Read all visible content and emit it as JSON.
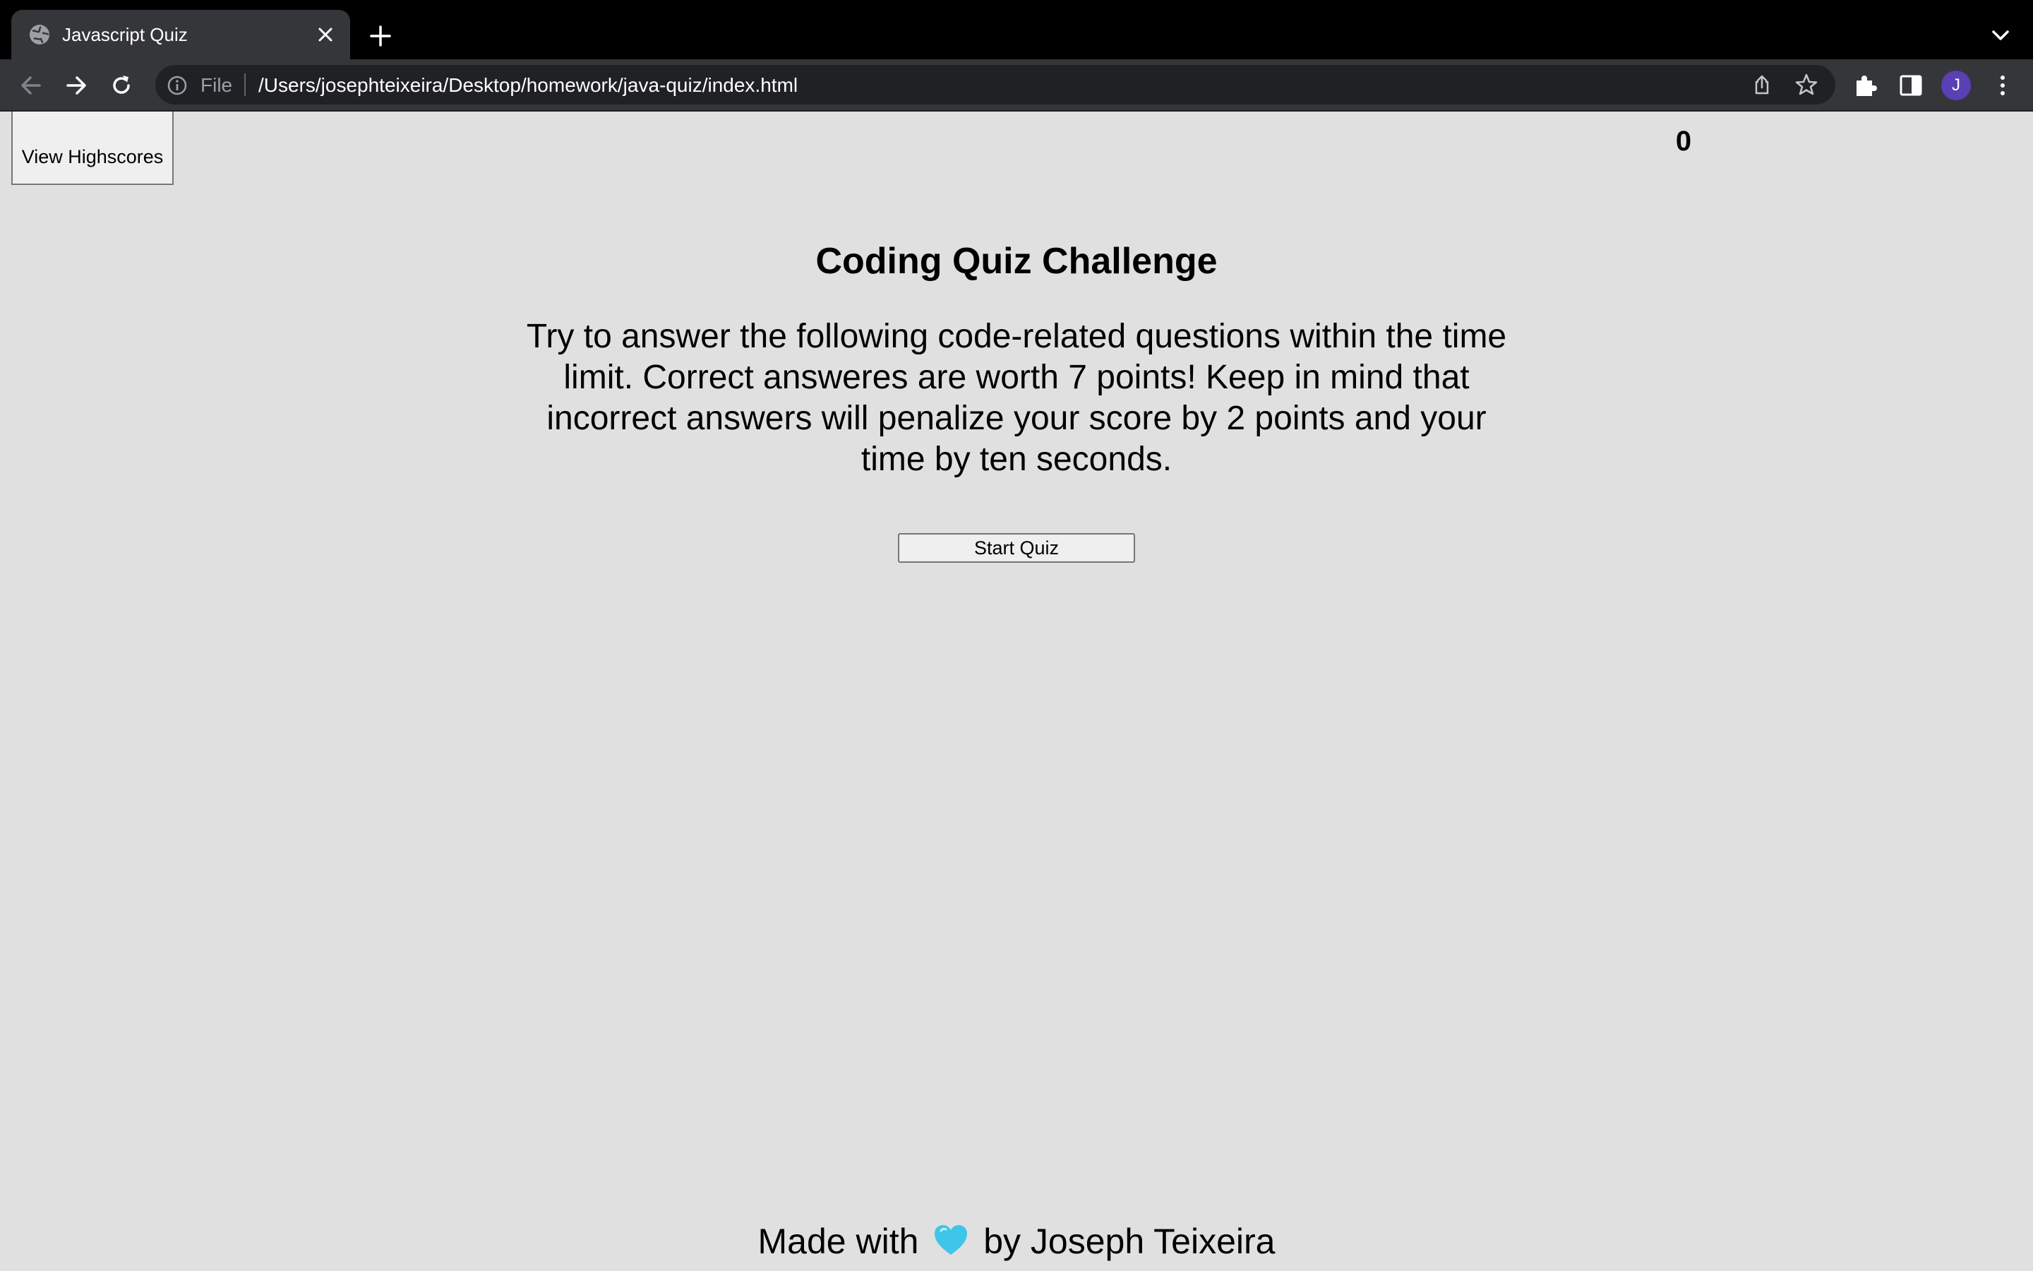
{
  "browser": {
    "tab_title": "Javascript Quiz",
    "omnibox_scheme": "File",
    "url": "/Users/josephteixeira/Desktop/homework/java-quiz/index.html",
    "profile_initial": "J"
  },
  "page": {
    "highscores_button": "View Highscores",
    "timer": "0",
    "title": "Coding Quiz Challenge",
    "instructions": "Try to answer the following code-related questions within the time limit. Correct answeres are worth 7 points! Keep in mind that incorrect answers will penalize your score by 2 points and your time by ten seconds.",
    "start_button": "Start Quiz",
    "footer_before": "Made with",
    "footer_after": "by Joseph Teixeira"
  },
  "colors": {
    "page_background": "#e0e0e0",
    "heart": "#3ec6e8",
    "avatar": "#5b3fb5"
  },
  "icons": {
    "tab_favicon": "globe-icon",
    "footer": "heart-icon"
  }
}
